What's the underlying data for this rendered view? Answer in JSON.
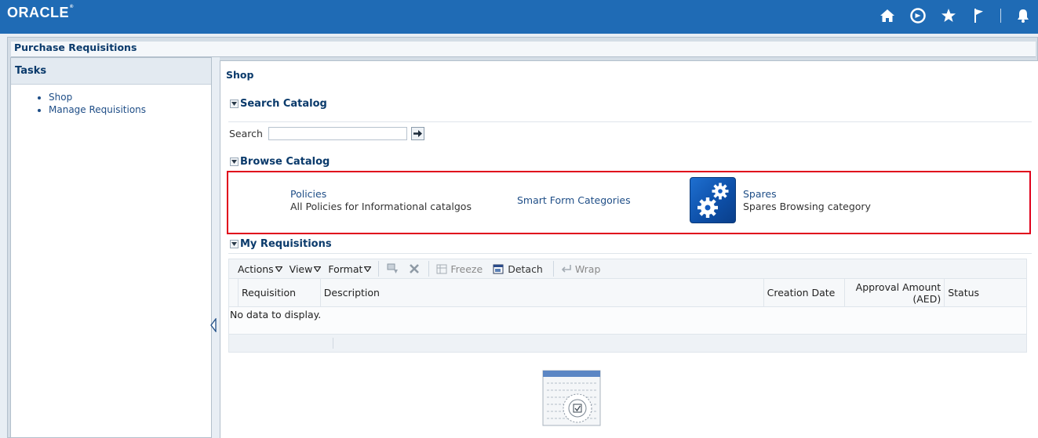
{
  "header": {
    "logo": "ORACLE",
    "logo_mark": "®",
    "icons": [
      "home-icon",
      "navigator-icon",
      "favorites-icon",
      "watchlist-flag-icon",
      "notifications-icon"
    ]
  },
  "page": {
    "title": "Purchase Requisitions"
  },
  "tasks": {
    "title": "Tasks",
    "items": [
      {
        "label": "Shop"
      },
      {
        "label": "Manage Requisitions"
      }
    ]
  },
  "shop": {
    "title": "Shop",
    "search_catalog": {
      "title": "Search Catalog",
      "search_label": "Search",
      "search_value": ""
    },
    "browse_catalog": {
      "title": "Browse Catalog",
      "categories": [
        {
          "name": "Policies",
          "description": "All Policies for Informational catalgos"
        },
        {
          "name": "Smart Form Categories",
          "description": ""
        },
        {
          "name": "Spares",
          "description": "Spares Browsing category",
          "icon": "gears-icon"
        }
      ]
    },
    "my_requisitions": {
      "title": "My Requisitions",
      "toolbar": {
        "actions": "Actions",
        "view": "View",
        "format": "Format",
        "freeze": "Freeze",
        "detach": "Detach",
        "wrap": "Wrap"
      },
      "columns": [
        "Requisition",
        "Description",
        "Creation Date",
        "Approval Amount (AED)",
        "Status"
      ],
      "empty_text": "No data to display."
    }
  },
  "colors": {
    "header_bg": "#1f6bb5",
    "title_text": "#0a3a6b",
    "link": "#1f4e87",
    "highlight_border": "#e0001b"
  }
}
